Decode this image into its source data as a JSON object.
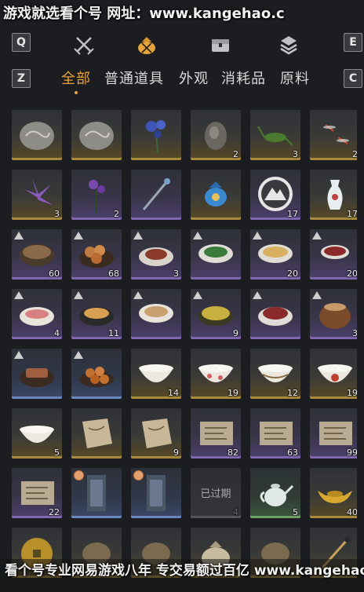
{
  "banner": {
    "text": "游戏就选看个号   网址：www.kangehao.c"
  },
  "tabs": {
    "left_key": "Q",
    "right_key": "E",
    "icons": [
      "crossed-swords-icon",
      "coin-pouch-icon",
      "treasure-chest-icon",
      "layers-icon"
    ],
    "accent": "#e7a43c"
  },
  "subtabs": {
    "left_key": "Z",
    "right_key": "C",
    "items": [
      "全部",
      "普通道具",
      "外观",
      "消耗品",
      "原料"
    ],
    "active_index": 0
  },
  "inventory": {
    "row1": [
      {
        "icon": "stone-fossil-icon",
        "qty": "",
        "rarity": "gold"
      },
      {
        "icon": "stone-fossil-icon",
        "qty": "",
        "rarity": "gold"
      },
      {
        "icon": "blue-flower-icon",
        "qty": "",
        "rarity": "gold"
      },
      {
        "icon": "ore-rock-icon",
        "qty": "2",
        "rarity": "gold"
      },
      {
        "icon": "cricket-icon",
        "qty": "3",
        "rarity": "gold"
      },
      {
        "icon": "dragonflies-icon",
        "qty": "2",
        "rarity": "gold"
      }
    ],
    "row2": [
      {
        "icon": "purple-flower-icon",
        "qty": "3",
        "rarity": "gold"
      },
      {
        "icon": "purple-herb-icon",
        "qty": "2",
        "rarity": "purple"
      },
      {
        "icon": "staff-icon",
        "qty": "",
        "rarity": "purple"
      },
      {
        "icon": "blue-pouch-icon",
        "qty": "",
        "rarity": "gold"
      },
      {
        "icon": "mountain-emblem-icon",
        "qty": "17",
        "rarity": "purple"
      },
      {
        "icon": "porcelain-vase-icon",
        "qty": "17",
        "rarity": "gold"
      }
    ],
    "row3": [
      {
        "icon": "stew-bowl-icon",
        "qty": "60",
        "rarity": "purple",
        "badge": true
      },
      {
        "icon": "buns-icon",
        "qty": "68",
        "rarity": "purple",
        "badge": true
      },
      {
        "icon": "meat-dish-icon",
        "qty": "3",
        "rarity": "purple",
        "badge": true
      },
      {
        "icon": "greens-bowl-icon",
        "qty": "",
        "rarity": "purple",
        "badge": true
      },
      {
        "icon": "noodle-bowl-icon",
        "qty": "20",
        "rarity": "purple",
        "badge": true
      },
      {
        "icon": "soup-bowl-icon",
        "qty": "20",
        "rarity": "purple",
        "badge": true
      }
    ],
    "row4": [
      {
        "icon": "fish-dish-icon",
        "qty": "4",
        "rarity": "purple",
        "badge": true
      },
      {
        "icon": "egg-dish-icon",
        "qty": "11",
        "rarity": "purple",
        "badge": true
      },
      {
        "icon": "porridge-bowl-icon",
        "qty": "",
        "rarity": "purple",
        "badge": true
      },
      {
        "icon": "noodle-plate-icon",
        "qty": "9",
        "rarity": "purple",
        "badge": true
      },
      {
        "icon": "flower-dish-icon",
        "qty": "",
        "rarity": "purple",
        "badge": true
      },
      {
        "icon": "clay-pot-icon",
        "qty": "3",
        "rarity": "purple",
        "badge": true
      }
    ],
    "row5": [
      {
        "icon": "braised-meat-icon",
        "qty": "",
        "rarity": "blue",
        "badge": true
      },
      {
        "icon": "meatballs-icon",
        "qty": "",
        "rarity": "blue",
        "badge": true
      },
      {
        "icon": "white-bowl-icon",
        "qty": "14",
        "rarity": "gold"
      },
      {
        "icon": "pink-bowl-icon",
        "qty": "19",
        "rarity": "gold"
      },
      {
        "icon": "ornate-bowl-icon",
        "qty": "12",
        "rarity": "gold"
      },
      {
        "icon": "rooster-bowl-icon",
        "qty": "19",
        "rarity": "gold"
      }
    ],
    "row6": [
      {
        "icon": "plain-bowl-icon",
        "qty": "5",
        "rarity": "gold"
      },
      {
        "icon": "scroll-icon",
        "qty": "",
        "rarity": "gold"
      },
      {
        "icon": "scroll-icon",
        "qty": "9",
        "rarity": "gold"
      },
      {
        "icon": "letter-icon",
        "qty": "82",
        "rarity": "purple"
      },
      {
        "icon": "letter-icon",
        "qty": "63",
        "rarity": "purple"
      },
      {
        "icon": "letter-icon",
        "qty": "99",
        "rarity": "purple"
      }
    ],
    "row7": [
      {
        "icon": "letter-icon",
        "qty": "22",
        "rarity": "purple"
      },
      {
        "icon": "ticket-icon",
        "qty": "",
        "rarity": "blue",
        "clock": true
      },
      {
        "icon": "ticket-icon",
        "qty": "",
        "rarity": "blue",
        "clock": true
      },
      {
        "icon": "expired-slot",
        "qty": "4",
        "rarity": "gray",
        "expired_text": "已过期"
      },
      {
        "icon": "teapot-icon",
        "qty": "5",
        "rarity": "green"
      },
      {
        "icon": "gold-ingot-icon",
        "qty": "40",
        "rarity": "gold"
      }
    ],
    "row8": [
      {
        "icon": "coin-icon",
        "qty": "",
        "rarity": "gold"
      },
      {
        "icon": "misc-icon",
        "qty": "",
        "rarity": "gold"
      },
      {
        "icon": "misc-icon",
        "qty": "",
        "rarity": "gold"
      },
      {
        "icon": "sack-icon",
        "qty": "",
        "rarity": "gold"
      },
      {
        "icon": "misc-icon",
        "qty": "",
        "rarity": "gold"
      },
      {
        "icon": "brush-icon",
        "qty": "",
        "rarity": "gold"
      }
    ]
  },
  "footer": {
    "text": "看个号专业网易游戏八年  专交易额过百亿  www.kangehao.com"
  }
}
